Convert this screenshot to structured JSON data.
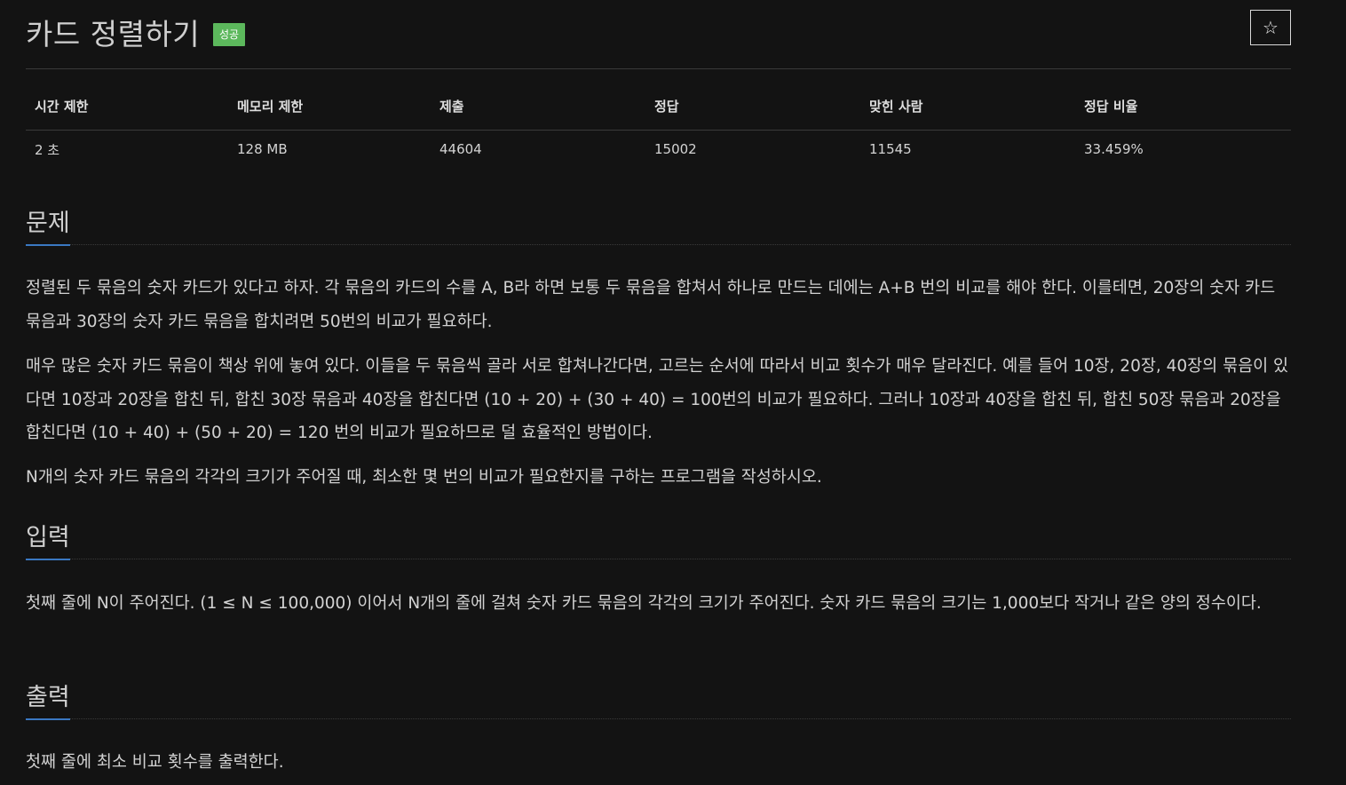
{
  "header": {
    "title": "카드 정렬하기",
    "badge": "성공",
    "star_icon": "☆"
  },
  "stats": {
    "headers": [
      "시간 제한",
      "메모리 제한",
      "제출",
      "정답",
      "맞힌 사람",
      "정답 비율"
    ],
    "values": [
      "2 초",
      "128 MB",
      "44604",
      "15002",
      "11545",
      "33.459%"
    ]
  },
  "problem": {
    "heading": "문제",
    "paragraphs": [
      "정렬된 두 묶음의 숫자 카드가 있다고 하자. 각 묶음의 카드의 수를 A, B라 하면 보통 두 묶음을 합쳐서 하나로 만드는 데에는 A+B 번의 비교를 해야 한다. 이를테면, 20장의 숫자 카드 묶음과 30장의 숫자 카드 묶음을 합치려면 50번의 비교가 필요하다.",
      "매우 많은 숫자 카드 묶음이 책상 위에 놓여 있다. 이들을 두 묶음씩 골라 서로 합쳐나간다면, 고르는 순서에 따라서 비교 횟수가 매우 달라진다. 예를 들어 10장, 20장, 40장의 묶음이 있다면 10장과 20장을 합친 뒤, 합친 30장 묶음과 40장을 합친다면 (10 + 20) + (30 + 40) = 100번의 비교가 필요하다. 그러나 10장과 40장을 합친 뒤, 합친 50장 묶음과 20장을 합친다면 (10 + 40) + (50 + 20) = 120 번의 비교가 필요하므로 덜 효율적인 방법이다.",
      "N개의 숫자 카드 묶음의 각각의 크기가 주어질 때, 최소한 몇 번의 비교가 필요한지를 구하는 프로그램을 작성하시오."
    ]
  },
  "input": {
    "heading": "입력",
    "text": "첫째 줄에 N이 주어진다. (1 ≤ N ≤ 100,000) 이어서 N개의 줄에 걸쳐 숫자 카드 묶음의 각각의 크기가 주어진다. 숫자 카드 묶음의 크기는 1,000보다 작거나 같은 양의 정수이다."
  },
  "output": {
    "heading": "출력",
    "text": "첫째 줄에 최소 비교 횟수를 출력한다."
  },
  "colors": {
    "background": "#131313",
    "success_badge": "#5cb85c",
    "section_accent": "#3a78c2"
  }
}
